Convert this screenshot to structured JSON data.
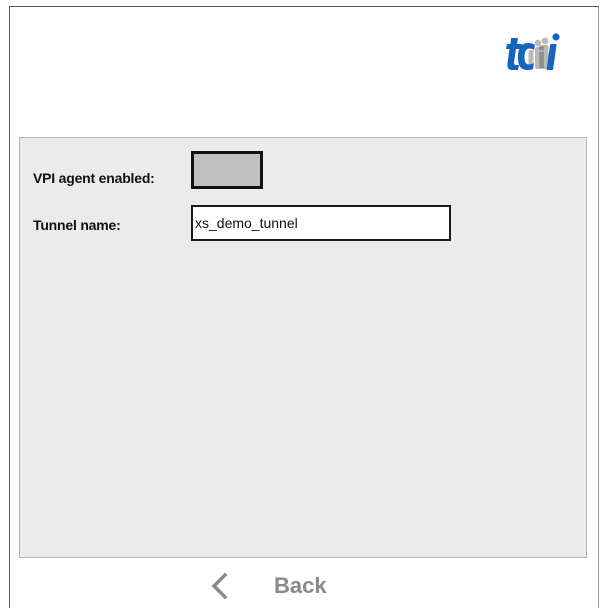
{
  "logo": {
    "text": "tcm",
    "icon": "tcm-logo"
  },
  "form": {
    "vpi_agent_label": "VPI agent enabled:",
    "vpi_agent_enabled": false,
    "tunnel_name_label": "Tunnel name:",
    "tunnel_name_value": "xs_demo_tunnel"
  },
  "nav": {
    "back_label": "Back",
    "back_icon": "chevron-left-icon"
  },
  "colors": {
    "logo_blue": "#1565c0",
    "panel_bg": "#ebebeb",
    "toggle_off": "#c0c0c0",
    "back_gray": "#8a8a8a"
  }
}
